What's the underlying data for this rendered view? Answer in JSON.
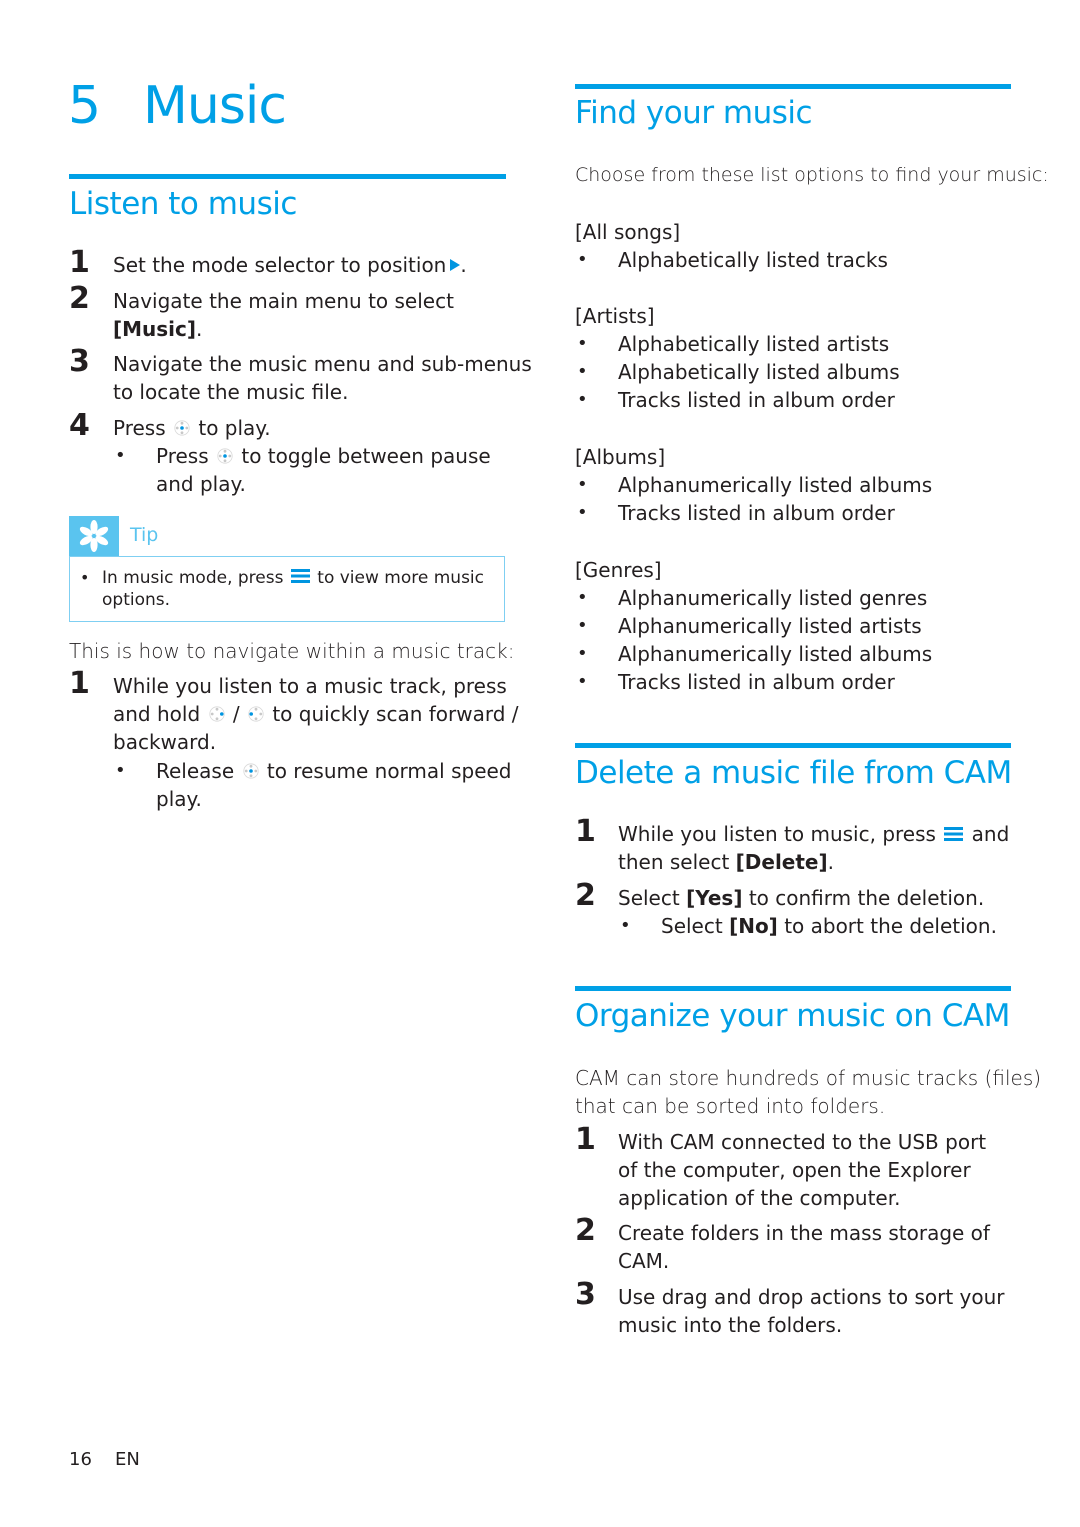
{
  "chapter": {
    "number": "5",
    "title": "Music"
  },
  "listen": {
    "heading": "Listen to music",
    "steps": [
      {
        "num": "1",
        "text_before": "Set the mode selector to position",
        "text_after": ".",
        "icon": "play-icon"
      },
      {
        "num": "2",
        "line1": "Navigate the main menu to select",
        "bracket": "[Music]",
        "after": "."
      },
      {
        "num": "3",
        "line1": "Navigate the music menu and sub-menus",
        "line2": "to locate the music file."
      },
      {
        "num": "4",
        "before": "Press",
        "after": "to play.",
        "icon": "navigation-pad-center-icon",
        "bullet": {
          "before": "Press",
          "after": "to toggle between pause",
          "line2": "and play."
        }
      }
    ],
    "tip": {
      "label": "Tip",
      "before": "In music mode, press",
      "after": "to view more music",
      "line2": "options."
    },
    "navigate_intro": "This is how to navigate within a music track:",
    "nav_step": {
      "num": "1",
      "line1": "While you listen to a music track, press",
      "line2_before": "and hold",
      "slash": "/",
      "line2_after": "to quickly scan forward /",
      "line3": "backward.",
      "bullet": {
        "before": "Release",
        "after": "to resume normal speed",
        "line2": "play."
      }
    }
  },
  "find": {
    "heading": "Find your music",
    "intro": "Choose from these list options to find your music:",
    "categories": [
      {
        "name": "[All songs]",
        "items": [
          "Alphabetically listed tracks"
        ]
      },
      {
        "name": "[Artists]",
        "items": [
          "Alphabetically listed artists",
          "Alphabetically listed albums",
          "Tracks listed in album order"
        ]
      },
      {
        "name": "[Albums]",
        "items": [
          "Alphanumerically listed albums",
          "Tracks listed in album order"
        ]
      },
      {
        "name": "[Genres]",
        "items": [
          "Alphanumerically listed genres",
          "Alphanumerically listed artists",
          "Alphanumerically listed albums",
          "Tracks listed in album order"
        ]
      }
    ]
  },
  "delete": {
    "heading": "Delete a music file from CAM",
    "step1": {
      "num": "1",
      "before": "While you listen to music, press",
      "after": "and",
      "line2_before": "then select",
      "bracket": "[Delete]",
      "line2_after": "."
    },
    "step2": {
      "num": "2",
      "before": "Select",
      "bracket": "[Yes]",
      "after": "to confirm the deletion.",
      "bullet": {
        "before": "Select",
        "bracket": "[No]",
        "after": "to abort the deletion."
      }
    }
  },
  "organize": {
    "heading": "Organize your music on CAM",
    "intro_line1": "CAM can store hundreds of music tracks (files)",
    "intro_line2": "that can be sorted into folders.",
    "steps": [
      {
        "num": "1",
        "lines": [
          "With CAM connected to the USB port",
          "of the computer, open the Explorer",
          "application of the computer."
        ]
      },
      {
        "num": "2",
        "lines": [
          "Create folders in the mass storage of",
          "CAM."
        ]
      },
      {
        "num": "3",
        "lines": [
          "Use drag and drop actions to sort your",
          "music into the folders."
        ]
      }
    ]
  },
  "footer": {
    "page": "16",
    "lang": "EN"
  },
  "colors": {
    "accent": "#00a0e6",
    "tip_accent": "#5ac4ef",
    "text": "#231f20"
  }
}
